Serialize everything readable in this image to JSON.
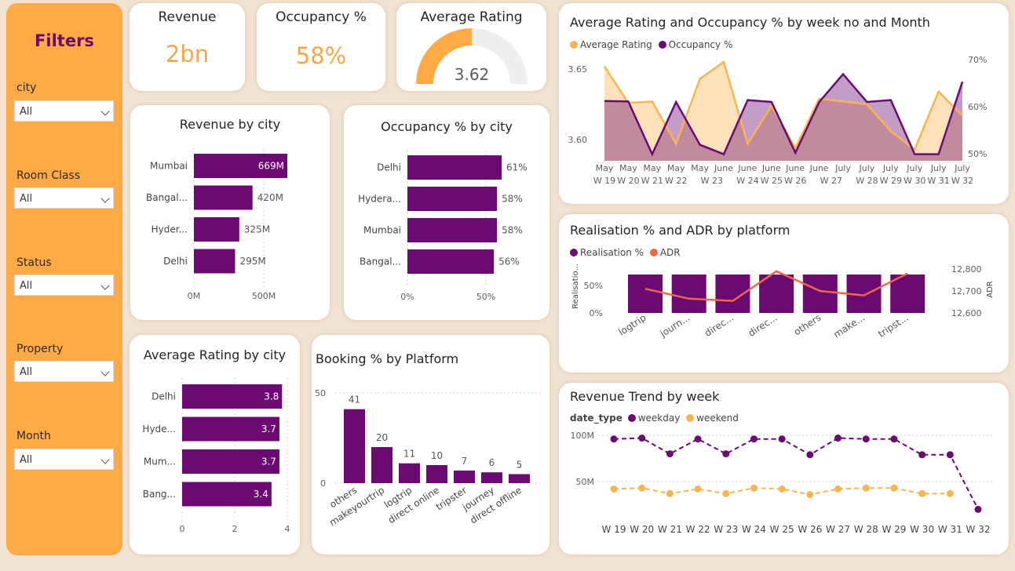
{
  "colors": {
    "purple": "#6b0a72",
    "orange": "#ffaa45",
    "orange_light": "#f8b452",
    "adr_red": "#f0664a"
  },
  "filters": {
    "title": "Filters",
    "items": [
      {
        "label": "city",
        "value": "All"
      },
      {
        "label": "Room Class",
        "value": "All"
      },
      {
        "label": "Status",
        "value": "All"
      },
      {
        "label": "Property",
        "value": "All"
      },
      {
        "label": "Month",
        "value": "All"
      }
    ]
  },
  "kpis": {
    "revenue": {
      "title": "Revenue",
      "value": "2bn"
    },
    "occupancy": {
      "title": "Occupancy %",
      "value": "58%"
    },
    "rating": {
      "title": "Average Rating",
      "value": "3.62",
      "fraction": 0.5
    }
  },
  "chart_data": [
    {
      "id": "revenue_by_city",
      "type": "bar",
      "orientation": "horizontal",
      "title": "Revenue by city",
      "categories": [
        "Mumbai",
        "Bangal...",
        "Hyder...",
        "Delhi"
      ],
      "values": [
        669,
        420,
        325,
        295
      ],
      "labels": [
        "669M",
        "420M",
        "325M",
        "295M"
      ],
      "xticks": [
        "0M",
        "500M"
      ],
      "xlim": [
        0,
        669
      ]
    },
    {
      "id": "occupancy_by_city",
      "type": "bar",
      "orientation": "horizontal",
      "title": "Occupancy % by city",
      "categories": [
        "Delhi",
        "Hydera...",
        "Mumbai",
        "Bangal..."
      ],
      "values": [
        61,
        58,
        58,
        56
      ],
      "labels": [
        "61%",
        "58%",
        "58%",
        "56%"
      ],
      "xticks": [
        "0%",
        "50%"
      ],
      "xlim": [
        0,
        61
      ]
    },
    {
      "id": "rating_by_city",
      "type": "bar",
      "orientation": "horizontal",
      "title": "Average Rating by city",
      "categories": [
        "Delhi",
        "Hyde...",
        "Mum...",
        "Bang..."
      ],
      "values": [
        3.8,
        3.7,
        3.7,
        3.4
      ],
      "labels": [
        "3.8",
        "3.7",
        "3.7",
        "3.4"
      ],
      "xticks": [
        "0",
        "2",
        "4"
      ],
      "xlim": [
        0,
        4
      ]
    },
    {
      "id": "booking_by_platform",
      "type": "bar",
      "title": "Booking % by Platform",
      "categories": [
        "others",
        "makeyourtrip",
        "logtrip",
        "direct online",
        "tripster",
        "journey",
        "direct offline"
      ],
      "values": [
        41,
        20,
        11,
        10,
        7,
        6,
        5
      ],
      "yticks": [
        "0",
        "50"
      ],
      "ylim": [
        0,
        50
      ]
    },
    {
      "id": "rating_occupancy_by_week",
      "type": "area",
      "title": "Average Rating and Occupancy % by week no and Month",
      "x_month": [
        "May",
        "May",
        "May",
        "May",
        "May",
        "June",
        "June",
        "June",
        "June",
        "June",
        "July",
        "July",
        "July",
        "July",
        "July",
        "July"
      ],
      "x_week": [
        "W 19",
        "W 20",
        "W 21",
        "W 22",
        "W 23",
        "W 24",
        "W 25",
        "W 26",
        "W 27",
        "W 28",
        "W 29",
        "W 30",
        "W 31",
        "W 32"
      ],
      "series": [
        {
          "name": "Average Rating",
          "values": [
            3.652,
            3.626,
            3.627,
            3.597,
            3.643,
            3.655,
            3.597,
            3.624,
            3.594,
            3.629,
            3.627,
            3.625,
            3.606,
            3.593,
            3.634,
            3.617
          ]
        },
        {
          "name": "Occupancy %",
          "values": [
            61.2,
            61.1,
            49.9,
            61.0,
            51.9,
            49.9,
            61.4,
            61.0,
            50.2,
            61.0,
            66.9,
            61.0,
            61.4,
            49.9,
            49.9,
            65.3
          ]
        }
      ],
      "y_left_ticks": [
        "3.60",
        "3.65"
      ],
      "y_left_lim": [
        3.585,
        3.66
      ],
      "y_right_ticks": [
        "50%",
        "60%",
        "70%"
      ],
      "y_right_lim": [
        48.5,
        71
      ]
    },
    {
      "id": "realisation_adr_by_platform",
      "type": "bar",
      "title": "Realisation % and ADR by platform",
      "categories": [
        "logtrip",
        "journ...",
        "direc...",
        "direc...",
        "others",
        "make...",
        "tripst..."
      ],
      "series": [
        {
          "name": "Realisation %",
          "values": [
            70,
            70,
            70,
            70,
            70,
            70,
            70
          ]
        },
        {
          "name": "ADR",
          "values": [
            12710,
            12665,
            12655,
            12790,
            12700,
            12680,
            12780
          ]
        }
      ],
      "ylabel_left": "Realisatio...",
      "y_left_ticks": [
        "0%",
        "50%"
      ],
      "y_left_lim": [
        0,
        100
      ],
      "ylabel_right": "ADR",
      "y_right_ticks": [
        "12,600",
        "12,700",
        "12,800"
      ],
      "y_right_lim": [
        12580,
        12820
      ]
    },
    {
      "id": "revenue_trend_by_week",
      "type": "line",
      "title": "Revenue Trend by week",
      "legend_title": "date_type",
      "x": [
        "W 19",
        "W 20",
        "W 21",
        "W 22",
        "W 23",
        "W 24",
        "W 25",
        "W 26",
        "W 27",
        "W 28",
        "W 29",
        "W 30",
        "W 31",
        "W 32"
      ],
      "series": [
        {
          "name": "weekday",
          "values": [
            96,
            97,
            80,
            96,
            80,
            96,
            96,
            79,
            97,
            96,
            96,
            79,
            79,
            20
          ]
        },
        {
          "name": "weekend",
          "values": [
            42,
            43,
            37,
            42,
            37,
            43,
            42,
            36,
            42,
            43,
            43,
            37,
            37,
            null
          ]
        }
      ],
      "yticks": [
        "50M",
        "100M"
      ],
      "ylim": [
        0,
        105
      ]
    }
  ]
}
